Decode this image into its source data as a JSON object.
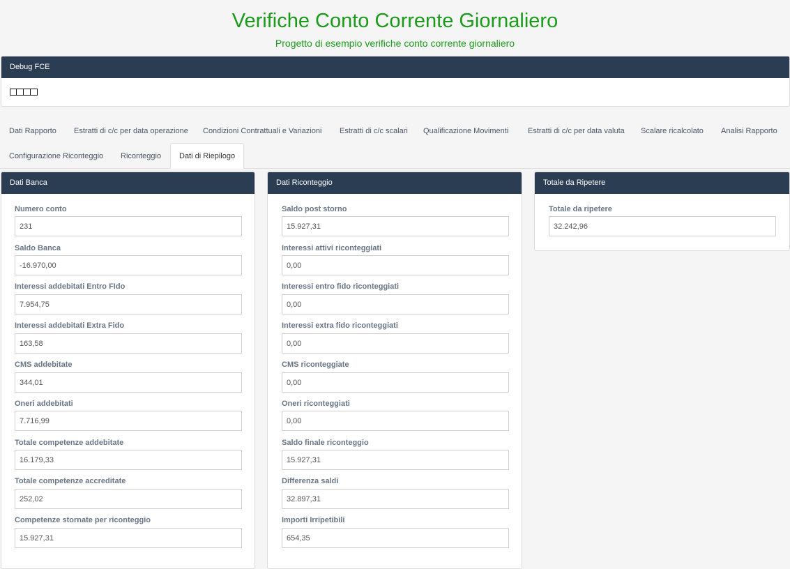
{
  "header": {
    "title": "Verifiche Conto Corrente Giornaliero",
    "subtitle": "Progetto di esempio verifiche conto corrente giornaliero"
  },
  "debug": {
    "title": "Debug FCE"
  },
  "tabs": [
    {
      "label": "Dati Rapporto"
    },
    {
      "label": "Estratti di c/c per data operazione"
    },
    {
      "label": "Condizioni Contrattuali e Variazioni"
    },
    {
      "label": "Estratti di c/c scalari"
    },
    {
      "label": "Qualificazione Movimenti"
    },
    {
      "label": "Estratti di c/c per data valuta"
    },
    {
      "label": "Scalare ricalcolato"
    },
    {
      "label": "Analisi Rapporto"
    },
    {
      "label": "Configurazione Riconteggio"
    },
    {
      "label": "Riconteggio"
    },
    {
      "label": "Dati di Riepilogo",
      "active": true
    }
  ],
  "banca": {
    "title": "Dati Banca",
    "fields": [
      {
        "label": "Numero conto",
        "value": "231"
      },
      {
        "label": "Saldo Banca",
        "value": "-16.970,00"
      },
      {
        "label": "Interessi addebitati Entro FIdo",
        "value": "7.954,75"
      },
      {
        "label": "Interessi addebitati Extra Fido",
        "value": "163,58"
      },
      {
        "label": "CMS addebitate",
        "value": "344,01"
      },
      {
        "label": "Oneri addebitati",
        "value": "7.716,99"
      },
      {
        "label": "Totale competenze addebitate",
        "value": "16.179,33"
      },
      {
        "label": "Totale competenze accreditate",
        "value": "252,02"
      },
      {
        "label": "Competenze stornate per riconteggio",
        "value": "15.927,31"
      }
    ]
  },
  "riconteggio": {
    "title": "Dati Riconteggio",
    "fields": [
      {
        "label": "Saldo post storno",
        "value": "15.927,31"
      },
      {
        "label": "Interessi attivi riconteggiati",
        "value": "0,00"
      },
      {
        "label": "Interessi entro fido riconteggiati",
        "value": "0,00"
      },
      {
        "label": "Interessi extra fido riconteggiati",
        "value": "0,00"
      },
      {
        "label": "CMS riconteggiate",
        "value": "0,00"
      },
      {
        "label": "Oneri riconteggiati",
        "value": "0,00"
      },
      {
        "label": "Saldo finale riconteggio",
        "value": "15.927,31"
      },
      {
        "label": "Differenza saldi",
        "value": "32.897,31"
      },
      {
        "label": "Importi Irripetibili",
        "value": "654,35"
      }
    ]
  },
  "ripetere": {
    "title": "Totale da Ripetere",
    "fields": [
      {
        "label": "Totale da ripetere",
        "value": "32.242,96"
      }
    ]
  }
}
